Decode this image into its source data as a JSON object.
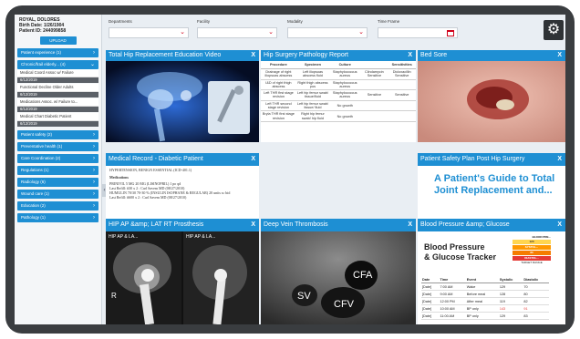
{
  "patient": {
    "name": "ROYAL, DOLORES",
    "birth_date": "Birth Date: 1/26/1904",
    "patient_id": "Patient ID: 244099858"
  },
  "sidebar": {
    "upload_label": "UPLOAD",
    "items": [
      {
        "label": "Patient experience (1)"
      },
      {
        "label": "Chronic/frail elderly... (4)"
      }
    ],
    "subitems": [
      {
        "label": "Medical Coord Assoc w/ Failure",
        "date": "6/12/2019"
      },
      {
        "label": "Functional Decline Older Adults",
        "date": "6/12/2019"
      },
      {
        "label": "Medications Assoc. w/ Failure to...",
        "date": "6/12/2019"
      },
      {
        "label": "Medical Chart Diabetic Patient",
        "date": "6/12/2019"
      }
    ],
    "more_items": [
      {
        "label": "Patient safety (2)"
      },
      {
        "label": "Preventative health (1)"
      },
      {
        "label": "Care Coordination (2)"
      },
      {
        "label": "Regulations (1)"
      },
      {
        "label": "Radiology (6)"
      },
      {
        "label": "Wound care (1)"
      },
      {
        "label": "Education (2)"
      },
      {
        "label": "Pathology (1)"
      }
    ]
  },
  "filters": {
    "departments": "Departments",
    "facility": "Facility",
    "modality": "Modality",
    "time_frame": "Time Frame"
  },
  "tiles": {
    "hip_video": {
      "title": "Total Hip Replacement Education Video"
    },
    "pathology": {
      "title": "Hip Surgery Pathology Report"
    },
    "bed_sore": {
      "title": "Bed Sore"
    },
    "medical_record": {
      "title": "Medical Record - Diabetic Patient"
    },
    "safety_plan": {
      "title": "Patient Safety Plan Post Hip Surgery"
    },
    "xray": {
      "title": "HIP AP &amp; LAT RT Prosthesis"
    },
    "dvt": {
      "title": "Deep Vein Thrombosis"
    },
    "bp": {
      "title": "Blood Pressure &amp; Glucose"
    }
  },
  "close_label": "X",
  "pathology_table": {
    "headers": [
      "Procedure",
      "Specimen",
      "Culture",
      "",
      "Sensitivities"
    ],
    "rows": [
      [
        "Drainage of right iliopsoas abscess",
        "Left iliopsoas abscess fluid",
        "Staphylococcus aureus",
        "Clindamycin Sensitive",
        "Dicloxacillin Sensitive"
      ],
      [
        "I&D of right thigh abscess",
        "Right thigh abscess pus",
        "Staphylococcus aureus",
        "",
        ""
      ],
      [
        "Left THR first stage revision",
        "Left hip femur swab/ tissue/fluid",
        "Staphylococcus aureus",
        "Sensitive",
        "Sensitive"
      ],
      [
        "Left THR second stage revision",
        "Left hip femur swab/ tissue/ fluid",
        "No growth",
        "",
        ""
      ],
      [
        "Bryla THR first stage revision",
        "Right hip femur swab/ hip fluid",
        "No growth",
        "",
        ""
      ]
    ]
  },
  "medical_record": {
    "lines": [
      "HYPERTENSION, BENIGN ESSENTIAL (ICD-401.1)",
      "Medications",
      "PRINIVIL 5 MG 20 MG (LISINOPRIL) 1 po qd",
      "Last Refill: #30 x 2 : Carl Savem MD (08/27/2010)",
      "HUMULIN 70/30 70-30 % (INSULIN ISOPHANE & REGULAR) 20 units sc bid",
      "Last Refill: #600 x 2 : Carl Savem MD (08/27/2010)"
    ]
  },
  "safety_guide": {
    "text": "A Patient's Guide to Total Joint Replacement and..."
  },
  "xray": {
    "label_1": "HIP AP & LA...",
    "label_2": "HIP AP & LA...",
    "marker": "R"
  },
  "dvt": {
    "labels": [
      "CFA",
      "SV",
      "CFV"
    ]
  },
  "bp_tracker": {
    "title_line1": "Blood Pressure",
    "title_line2": "& Glucose Tracker",
    "legend_title": "BLOOD PRE...",
    "legend": [
      {
        "label": "120",
        "color": "#ffd54f"
      },
      {
        "label": "SYSTOL...",
        "color": "#ff9800"
      },
      {
        "label": "80",
        "color": "#f57c00"
      },
      {
        "label": "DIASTOL...",
        "color": "#e53935"
      }
    ],
    "legend_caption": "TARGET RANGE",
    "headers": [
      "Date",
      "Time",
      "Event",
      "Systolic",
      "Diastolic"
    ],
    "rows": [
      [
        "[Date]",
        "7:00 AM",
        "Wake",
        "129",
        "70"
      ],
      [
        "[Date]",
        "9:00 AM",
        "Before meal",
        "128",
        "80"
      ],
      [
        "[Date]",
        "12:00 PM",
        "After meal",
        "119",
        "82"
      ],
      [
        "[Date]",
        "10:00 AM",
        "BP only",
        "143",
        "91"
      ],
      [
        "[Date]",
        "11:00 AM",
        "BP only",
        "129",
        "83"
      ]
    ],
    "value_color_high": "#e53935"
  }
}
